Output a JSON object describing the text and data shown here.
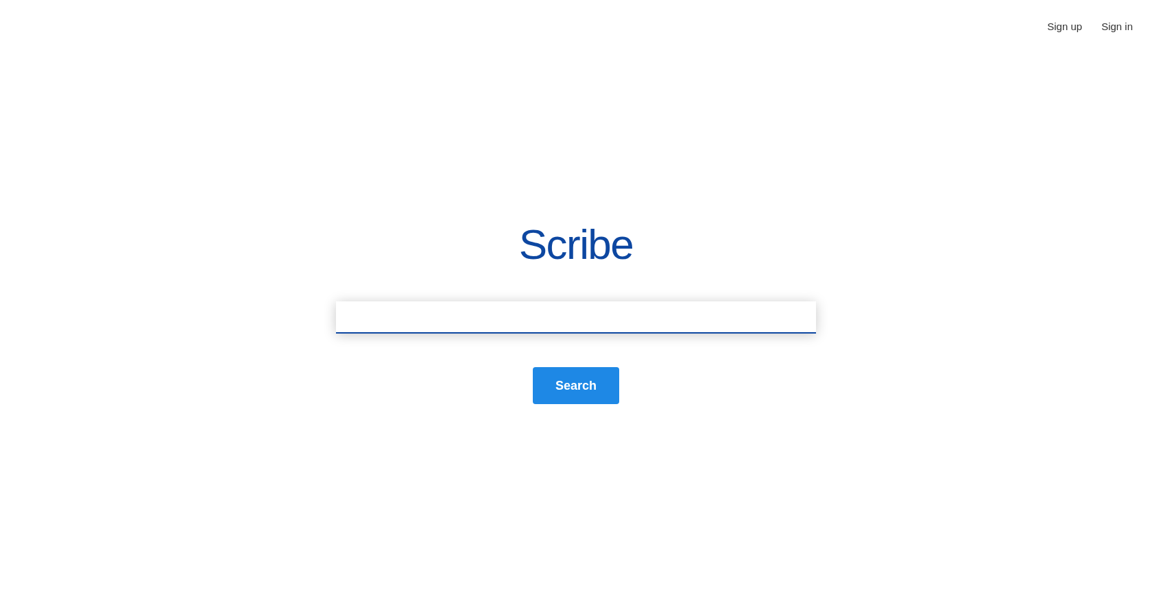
{
  "header": {
    "links": [
      {
        "label": "Sign up"
      },
      {
        "label": "Sign in"
      }
    ]
  },
  "logo": "Scribe",
  "search": {
    "button": "Search"
  }
}
